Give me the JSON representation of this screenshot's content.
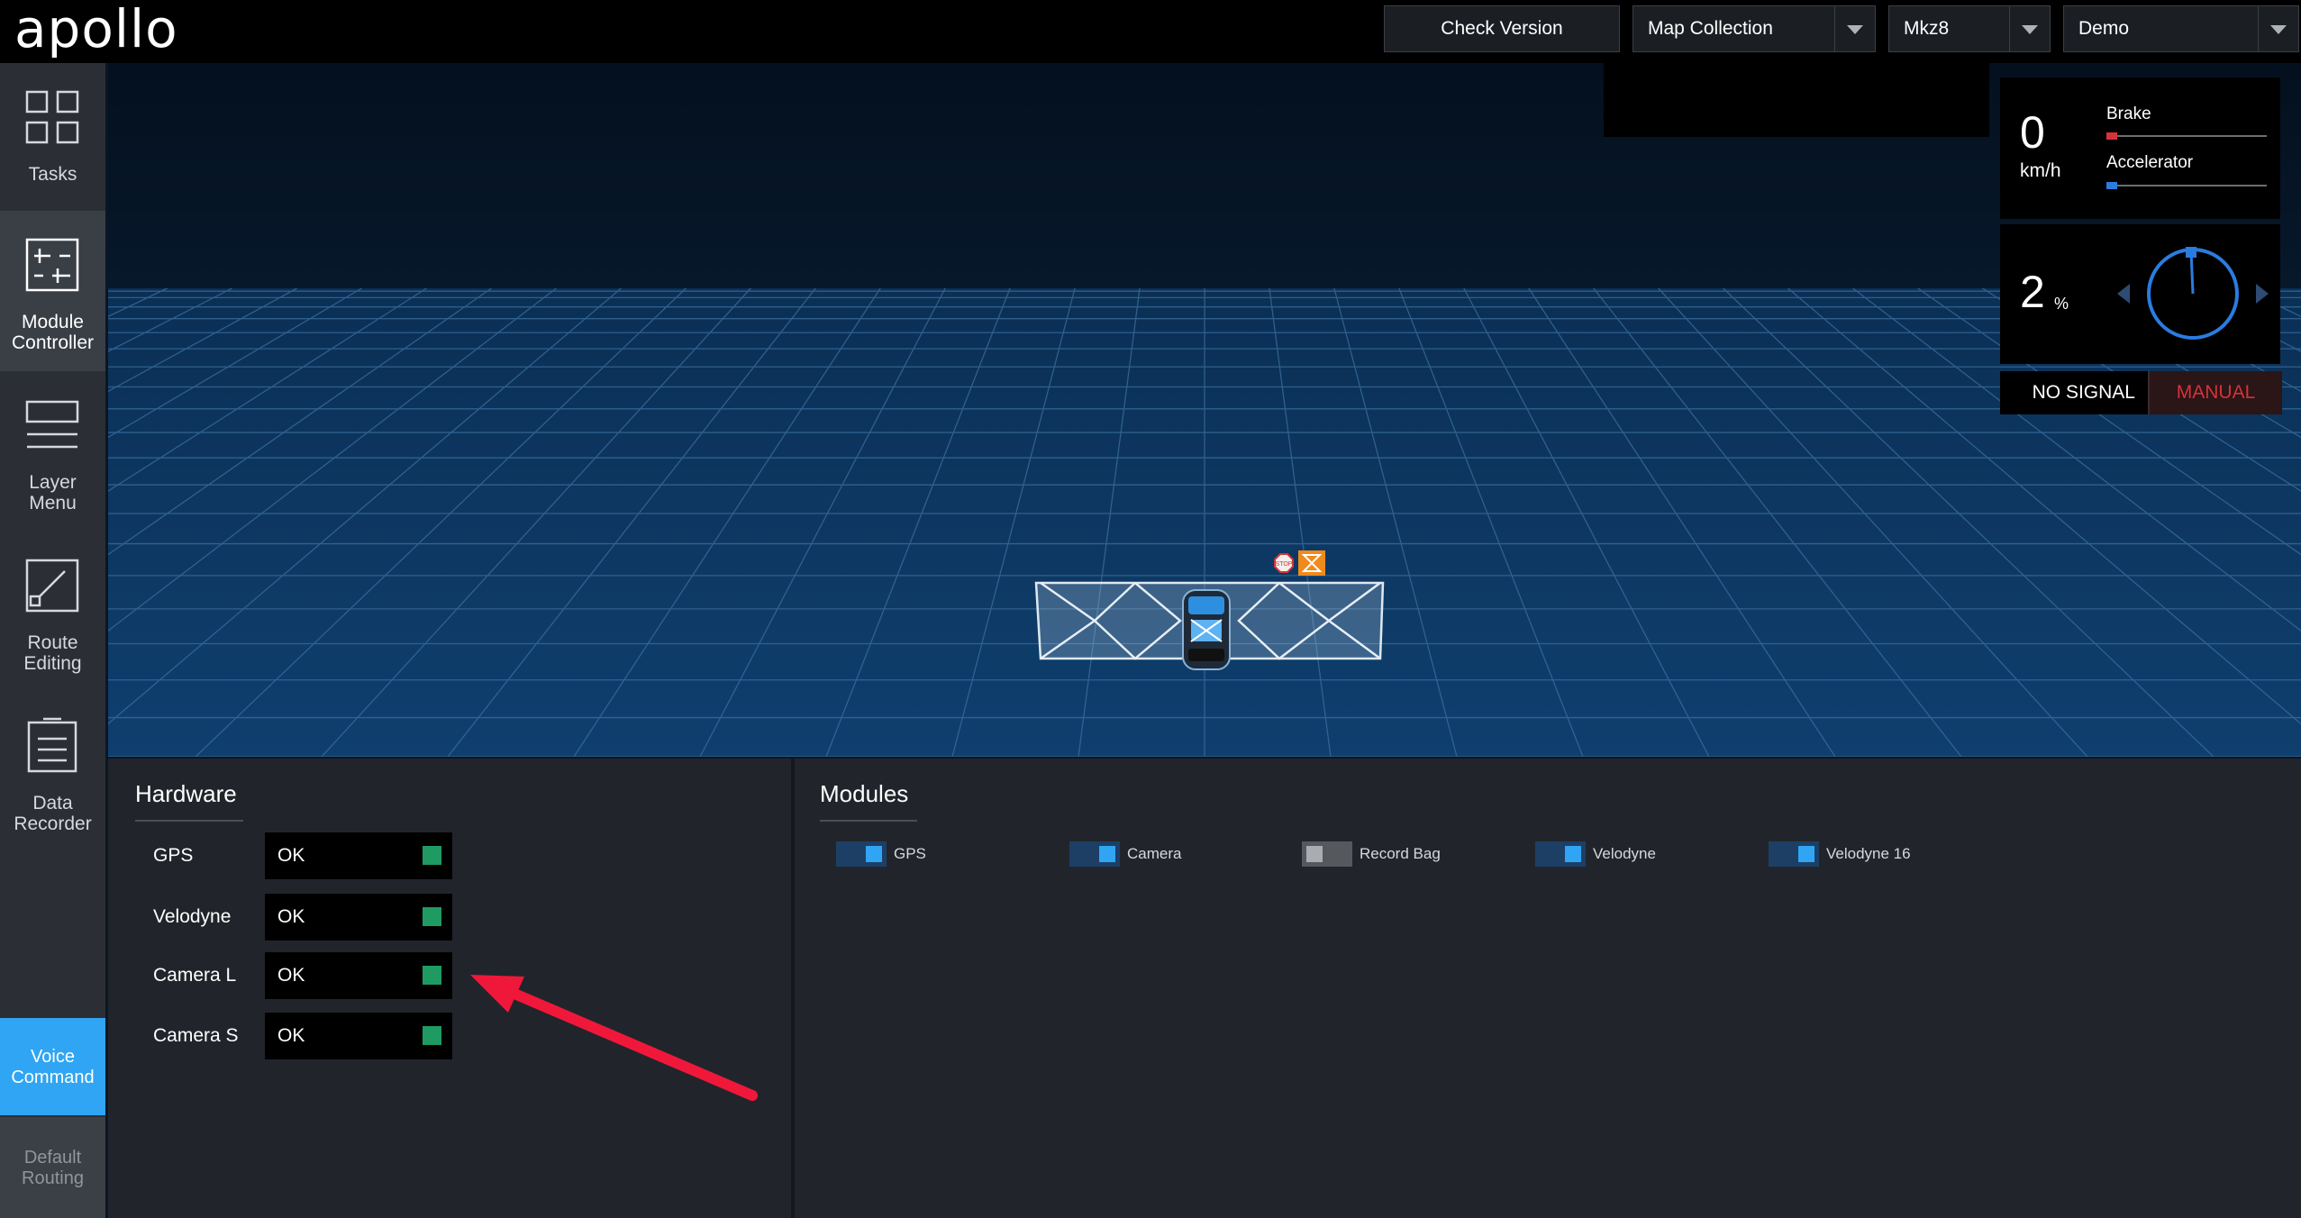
{
  "header": {
    "logo": "apollo",
    "check_version": "Check Version",
    "mode_select": "Map Collection",
    "vehicle_select": "Mkz8",
    "map_select": "Demo"
  },
  "sidebar": {
    "items": [
      {
        "label": "Tasks",
        "icon": "tasks-icon"
      },
      {
        "label": "Module\nController",
        "icon": "module-controller-icon"
      },
      {
        "label": "Layer\nMenu",
        "icon": "layer-menu-icon"
      },
      {
        "label": "Route\nEditing",
        "icon": "route-editing-icon"
      },
      {
        "label": "Data\nRecorder",
        "icon": "data-recorder-icon"
      }
    ],
    "voice_command": "Voice\nCommand",
    "default_routing": "Default\nRouting"
  },
  "scene": {
    "stop_sign": "STOP"
  },
  "dashboard": {
    "speed": "0",
    "speed_unit": "km/h",
    "brake_label": "Brake",
    "brake_level": 0,
    "accelerator_label": "Accelerator",
    "accelerator_level": 0,
    "steering": "2",
    "steering_unit": "%",
    "signal": "NO SIGNAL",
    "driving_mode": "MANUAL",
    "colors": {
      "brake": "#d6323b",
      "accelerator": "#2a7ce0",
      "manual": "#d6323b"
    }
  },
  "hardware": {
    "title": "Hardware",
    "items": [
      {
        "name": "GPS",
        "status": "OK"
      },
      {
        "name": "Velodyne",
        "status": "OK"
      },
      {
        "name": "Camera L",
        "status": "OK"
      },
      {
        "name": "Camera S",
        "status": "OK"
      }
    ],
    "ok_color": "#1f9a62"
  },
  "modules": {
    "title": "Modules",
    "items": [
      {
        "name": "GPS",
        "enabled": true
      },
      {
        "name": "Camera",
        "enabled": true
      },
      {
        "name": "Record Bag",
        "enabled": false
      },
      {
        "name": "Velodyne",
        "enabled": true
      },
      {
        "name": "Velodyne 16",
        "enabled": true
      }
    ]
  }
}
